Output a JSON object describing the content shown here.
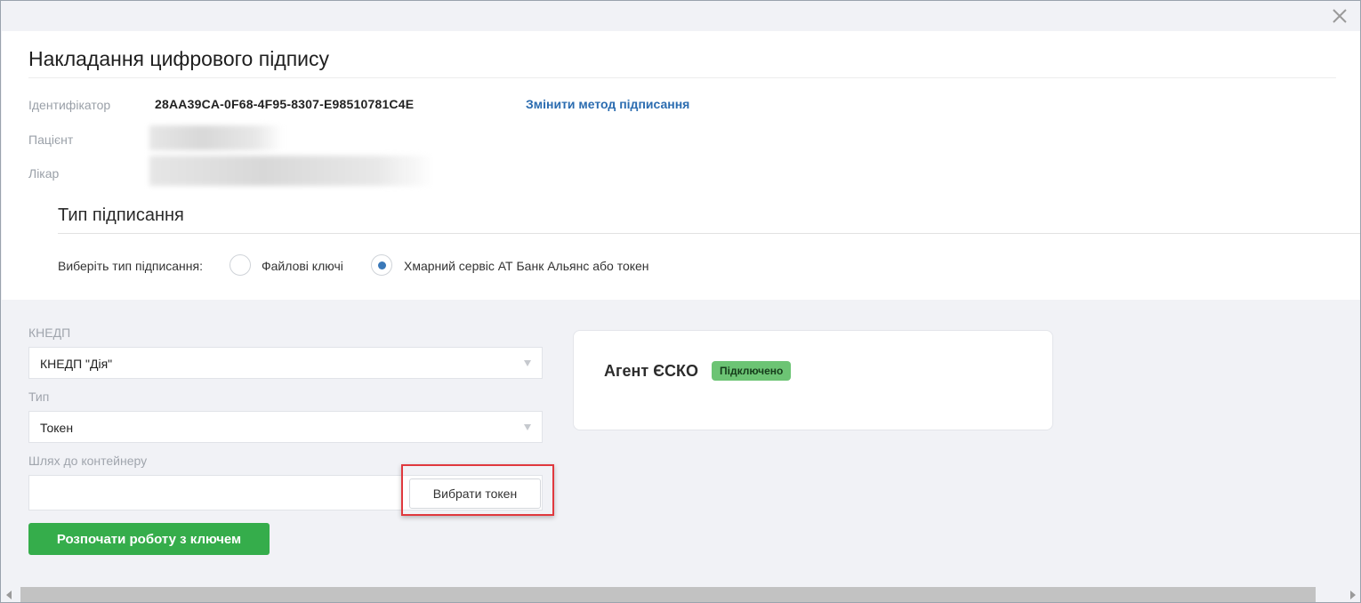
{
  "dialog": {
    "title": "Накладання цифрового підпису",
    "close_icon": "close-icon"
  },
  "info": {
    "identifier_label": "Ідентифікатор",
    "identifier_value": "28AA39CA-0F68-4F95-8307-E98510781C4E",
    "change_method_link": "Змінити метод підписання",
    "patient_label": "Пацієнт",
    "doctor_label": "Лікар"
  },
  "signing_type": {
    "section_title": "Тип підписання",
    "choose_label": "Виберіть тип підписання:",
    "options": [
      {
        "label": "Файлові ключі",
        "selected": false
      },
      {
        "label": "Хмарний сервіс АТ Банк Альянс або токен",
        "selected": true
      }
    ]
  },
  "form": {
    "kned_label": "КНЕДП",
    "kned_value": "КНЕДП \"Дія\"",
    "type_label": "Тип",
    "type_value": "Токен",
    "path_label": "Шлях до контейнеру",
    "path_value": "",
    "choose_token_button": "Вибрати токен",
    "start_button": "Розпочати роботу з ключем"
  },
  "agent": {
    "name": "Агент ЄСКО",
    "status": "Підключено"
  },
  "colors": {
    "accent_link": "#2b6cb0",
    "primary_button": "#35ad4b",
    "status_badge": "#6cc474",
    "highlight": "#e0393e",
    "radio_dot": "#3a78b8"
  }
}
